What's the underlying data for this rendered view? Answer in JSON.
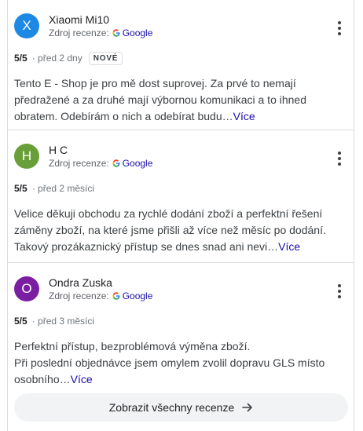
{
  "reviews": [
    {
      "initial": "X",
      "avatar_color": "#1e88e5",
      "name": "Xiaomi Mi10",
      "source_label": "Zdroj recenze:",
      "source_brand": "Google",
      "rating": "5/5",
      "date": "· před 2 dny",
      "badge": "NOVÉ",
      "text": "Tento E - Shop je pro mě dost suprovej. Za prvé to nemají předražené a za druhé mají výbornou komunikaci a to ihned obratem. Odebírám o nich a odebírat budu…",
      "more": "Více"
    },
    {
      "initial": "H",
      "avatar_color": "#689f38",
      "name": "H C",
      "source_label": "Zdroj recenze:",
      "source_brand": "Google",
      "rating": "5/5",
      "date": "· před 2 měsíci",
      "text": "Velice děkuji obchodu za rychlé dodání zboží a perfektní řešení záměny zboží, na které jsme přišli až více než měsíc po dodání. Takový prozákaznický přístup se dnes snad ani nevi…",
      "more": "Více"
    },
    {
      "initial": "O",
      "avatar_color": "#7b1fa2",
      "name": "Ondra Zuska",
      "source_label": "Zdroj recenze:",
      "source_brand": "Google",
      "rating": "5/5",
      "date": "· před 3 měsíci",
      "text": "Perfektní přístup, bezproblémová výměna zboží.\nPři poslední objednávce jsem omylem zvolil dopravu GLS místo osobního…",
      "more": "Více"
    }
  ],
  "show_all_label": "Zobrazit všechny recenze",
  "icons": {
    "source_logo": "google-g-icon",
    "more": "more-vert-icon",
    "show_all": "arrow-right-icon"
  }
}
